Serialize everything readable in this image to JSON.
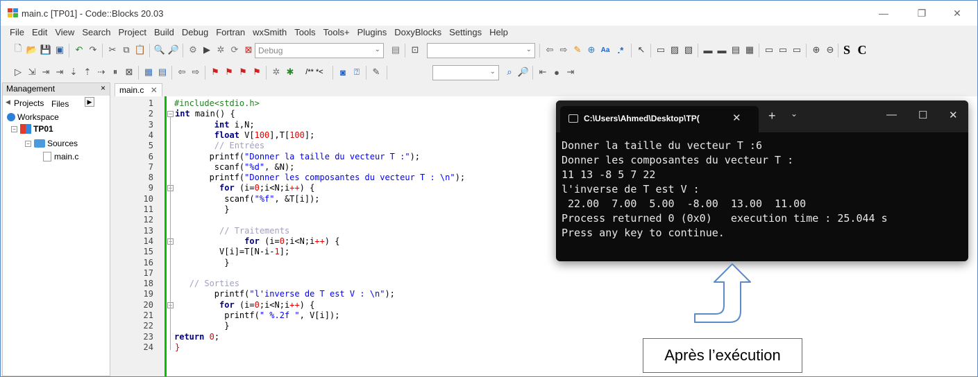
{
  "window": {
    "title": "main.c [TP01] - Code::Blocks 20.03",
    "minimize_glyph": "—",
    "maximize_glyph": "❐",
    "close_glyph": "✕"
  },
  "menu": [
    "File",
    "Edit",
    "View",
    "Search",
    "Project",
    "Build",
    "Debug",
    "Fortran",
    "wxSmith",
    "Tools",
    "Tools+",
    "Plugins",
    "DoxyBlocks",
    "Settings",
    "Help"
  ],
  "toolbar": {
    "build_target": "Debug",
    "font_buttons": [
      "S",
      "C"
    ],
    "comment_button": "/** *<"
  },
  "management": {
    "title": "Management",
    "close": "×",
    "tabs": [
      "Projects",
      "Files"
    ],
    "tree": {
      "workspace": "Workspace",
      "project": "TP01",
      "folder": "Sources",
      "file": "main.c"
    }
  },
  "editor": {
    "tab_label": "main.c",
    "tab_close": "✕",
    "line_numbers": [
      "1",
      "2",
      "3",
      "4",
      "5",
      "6",
      "7",
      "8",
      "9",
      "10",
      "11",
      "12",
      "13",
      "14",
      "15",
      "16",
      "17",
      "18",
      "19",
      "20",
      "21",
      "22",
      "23",
      "24"
    ]
  },
  "terminal": {
    "tab_title": "C:\\Users\\Ahmed\\Desktop\\TP(",
    "tab_close": "✕",
    "new_tab": "+",
    "dropdown": "⌄",
    "lines": [
      "Donner la taille du vecteur T :6",
      "Donner les composantes du vecteur T :",
      "11 13 -8 5 7 22",
      "l'inverse de T est V :",
      " 22.00  7.00  5.00  -8.00  13.00  11.00",
      "Process returned 0 (0x0)   execution time : 25.044 s",
      "Press any key to continue."
    ]
  },
  "annotation": {
    "caption": "Après l’exécution"
  }
}
